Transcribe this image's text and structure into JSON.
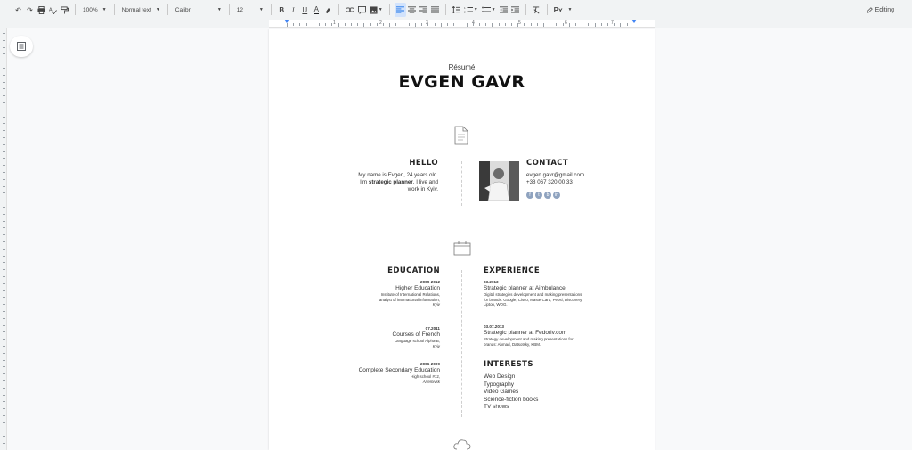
{
  "toolbar": {
    "zoom": "100%",
    "style": "Normal text",
    "font": "Calibri",
    "font_size": "12",
    "editing_label": "Editing"
  },
  "ruler": {
    "numbers": [
      "1",
      "2",
      "3",
      "4",
      "5",
      "6",
      "7"
    ]
  },
  "document": {
    "subtitle": "Résumé",
    "name": "EVGEN GAVR",
    "hello": {
      "heading": "HELLO",
      "line1": "My name is Evgen, 24 years old.",
      "line2_prefix": "I'm ",
      "line2_bold": "strategic planner",
      "line2_suffix": ". I live and",
      "line3": "work in Kyiv."
    },
    "contact": {
      "heading": "CONTACT",
      "email": "evgen.gavr@gmail.com",
      "phone": "+38 067 320 00 33"
    },
    "education": {
      "heading": "EDUCATION",
      "items": [
        {
          "date": "2009-2012",
          "title": "Higher Education",
          "desc1": "Institute of International Relations,",
          "desc2": "analyst of international information,",
          "place": "Kyiv"
        },
        {
          "date": "07.2011",
          "title": "Courses of French",
          "desc1": "Language school Alpha-B,",
          "place": "Kyiv"
        },
        {
          "date": "2006-2009",
          "title": "Complete Secondary Education",
          "desc1": "High school #12,",
          "place": "Artemivsk"
        }
      ]
    },
    "experience": {
      "heading": "EXPERIENCE",
      "items": [
        {
          "date": "03.2013",
          "title": "Strategic planner at Aimbulance",
          "desc1": "Digital strategies development and making presentations",
          "desc2": "for brands: Google, Cisco, MasterCard, Pepsi, Discovery,",
          "desc3": "Lipton, WOG."
        },
        {
          "date": "03.07.2013",
          "title": "Strategic planner at Fedoriv.com",
          "desc1": "Strategy development and making presentations for",
          "desc2": "brands: Ahmad, Datsotsky, KBM."
        }
      ]
    },
    "interests": {
      "heading": "INTERESTS",
      "items": [
        "Web Design",
        "Typography",
        "Video Games",
        "Science-fiction books",
        "TV shows"
      ]
    }
  }
}
